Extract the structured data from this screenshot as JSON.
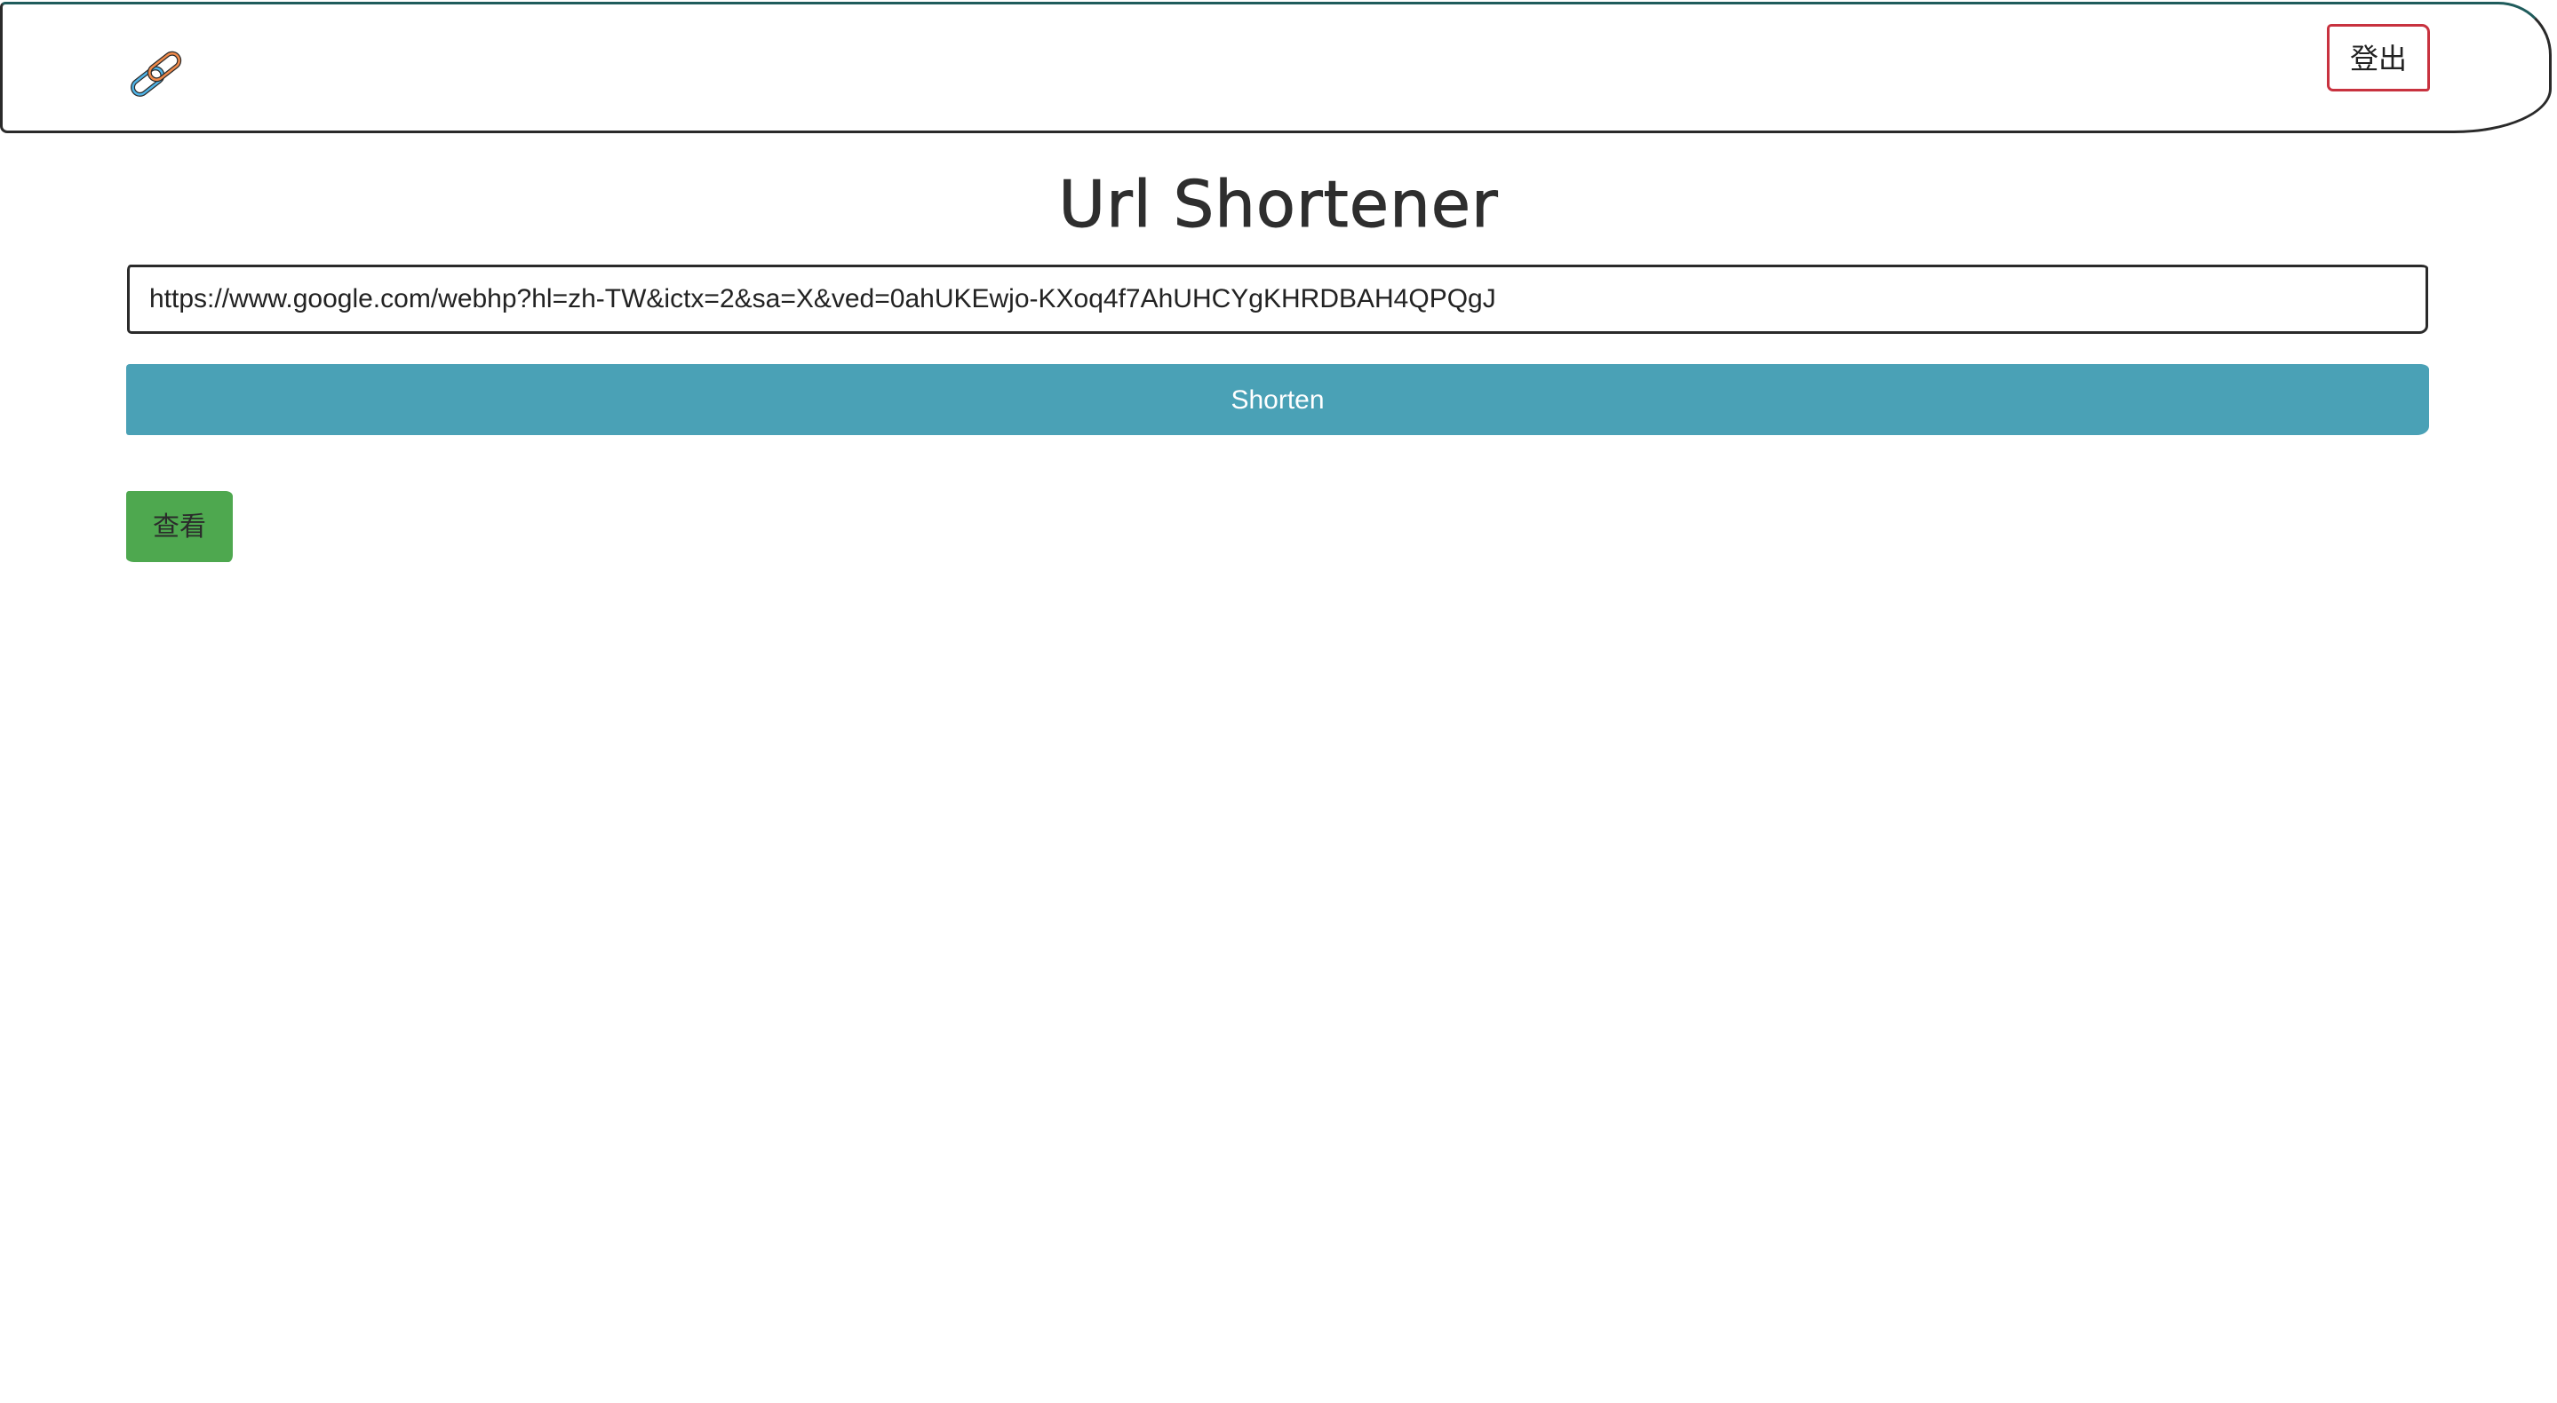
{
  "header": {
    "logo_icon": "link-chain-icon",
    "logout_label": "登出"
  },
  "main": {
    "title": "Url Shortener",
    "url_input": {
      "value": "https://www.google.com/webhp?hl=zh-TW&ictx=2&sa=X&ved=0ahUKEwjo-KXoq4f7AhUHCYgKHRDBAH4QPQgJ",
      "placeholder": ""
    },
    "shorten_label": "Shorten",
    "view_label": "查看"
  },
  "colors": {
    "shorten_button": "#4aa1b6",
    "view_button": "#4ea84f",
    "logout_border": "#c8323f"
  }
}
